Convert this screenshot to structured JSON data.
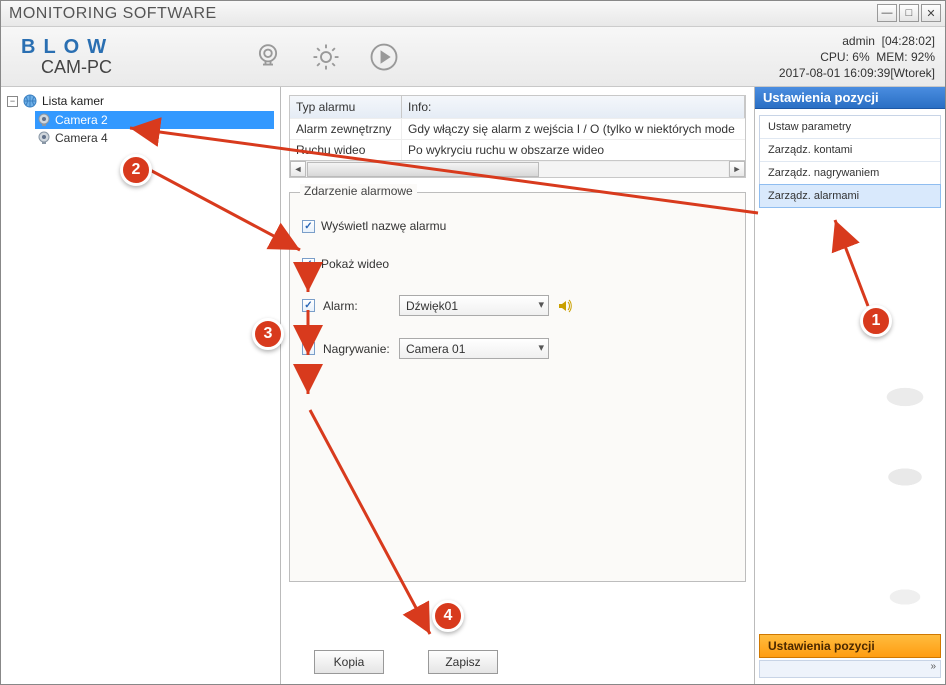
{
  "window": {
    "title": "MONITORING SOFTWARE"
  },
  "brand": {
    "line1": "BLOW",
    "line2": "CAM-PC"
  },
  "status": {
    "user": "admin",
    "session_time": "[04:28:02]",
    "cpu_label": "CPU:",
    "cpu_value": "6%",
    "mem_label": "MEM:",
    "mem_value": "92%",
    "datetime": "2017-08-01 16:09:39[Wtorek]"
  },
  "tree": {
    "root": "Lista kamer",
    "items": [
      {
        "label": "Camera 2",
        "selected": true
      },
      {
        "label": "Camera 4",
        "selected": false
      }
    ]
  },
  "alarm_table": {
    "headers": {
      "type": "Typ alarmu",
      "info": "Info:"
    },
    "rows": [
      {
        "type": "Alarm zewnętrzny",
        "info": "Gdy włączy się alarm z wejścia I / O (tylko w niektórych mode"
      },
      {
        "type": "Ruchu wideo",
        "info": "Po wykryciu ruchu w obszarze wideo"
      }
    ]
  },
  "fieldset": {
    "legend": "Zdarzenie alarmowe",
    "chk_show_name": "Wyświetl nazwę alarmu",
    "chk_show_video": "Pokaż wideo",
    "label_alarm": "Alarm:",
    "combo_alarm_value": "Dźwięk01",
    "label_recording": "Nagrywanie:",
    "combo_recording_value": "Camera 01"
  },
  "buttons": {
    "copy": "Kopia",
    "save": "Zapisz"
  },
  "right_panel": {
    "header": "Ustawienia pozycji",
    "items": [
      "Ustaw parametry",
      "Zarządz. kontami",
      "Zarządz. nagrywaniem",
      "Zarządz. alarmami"
    ],
    "active_index": 3,
    "footer_bar": "Ustawienia pozycji",
    "expand": "»"
  },
  "callouts": {
    "b1": "1",
    "b2": "2",
    "b3": "3",
    "b4": "4"
  }
}
